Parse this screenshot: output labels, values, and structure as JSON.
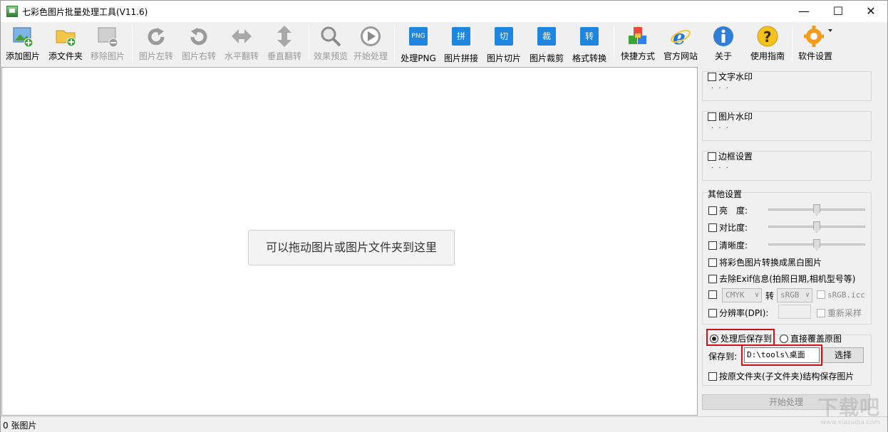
{
  "window": {
    "title": "七彩色图片批量处理工具(V11.6)",
    "minimize_glyph": "—",
    "maximize_glyph": "☐",
    "close_glyph": "✕"
  },
  "toolbar": {
    "add_image": "添加图片",
    "add_folder": "添文件夹",
    "remove_image": "移除图片",
    "rotate_left": "图片左转",
    "rotate_right": "图片右转",
    "flip_h": "水平翻转",
    "flip_v": "垂直翻转",
    "preview": "效果预览",
    "start": "开始处理",
    "png": "处理PNG",
    "png_icon_text": "PNG",
    "stitch": "图片拼接",
    "stitch_icon_text": "拼",
    "slice": "图片切片",
    "slice_icon_text": "切",
    "crop": "图片裁剪",
    "crop_icon_text": "裁",
    "convert": "格式转换",
    "convert_icon_text": "转",
    "shortcut": "快捷方式",
    "website": "官方网站",
    "about": "关于",
    "guide": "使用指南",
    "settings": "软件设置"
  },
  "canvas": {
    "drop_hint": "可以拖动图片或图片文件夹到这里"
  },
  "panel": {
    "text_watermark": "文字水印",
    "image_watermark": "图片水印",
    "border_settings": "边框设置",
    "dots": "· · ·",
    "other_settings": "其他设置",
    "brightness": "亮　度:",
    "contrast": "对比度:",
    "sharpness": "清晰度:",
    "to_grayscale": "将彩色图片转换成黑白图片",
    "remove_exif": "去除Exif信息(拍照日期,相机型号等)",
    "cmyk": "CMYK",
    "convert_to": "转",
    "srgb": "sRGB",
    "srgb_icc": "sRGB.icc",
    "resolution": "分辨率(DPI):",
    "resample": "重新采样",
    "save_after": "处理后保存到",
    "overwrite": "直接覆盖原图",
    "save_to_label": "保存到:",
    "save_path": "D:\\tools\\桌面",
    "choose": "选择",
    "keep_structure": "按原文件夹(子文件夹)结构保存图片",
    "start_button": "开始处理"
  },
  "status": {
    "count_text": "0 张图片"
  },
  "watermark": {
    "brand": "下载吧",
    "url": "www.xiazaiba.com"
  },
  "colors": {
    "accent_blue": "#1f86e0",
    "highlight_red": "#d0121b"
  }
}
